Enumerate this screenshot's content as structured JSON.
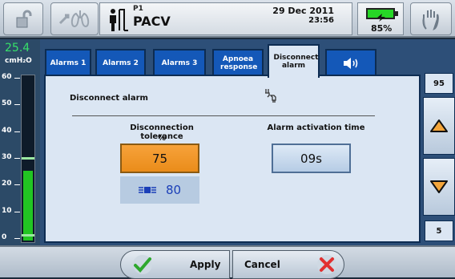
{
  "header": {
    "patient_id": "P1",
    "mode": "PACV",
    "date": "29 Dec 2011",
    "time": "23:56",
    "battery_percent": "85%"
  },
  "gauge": {
    "value": "25.4",
    "unit": "cmH₂O",
    "ticks": [
      "60",
      "50",
      "40",
      "30",
      "20",
      "10",
      "0"
    ],
    "fill_level": 25.4,
    "high_marker": 30,
    "low_marker": 2
  },
  "tabs": [
    {
      "label": "Alarms 1"
    },
    {
      "label": "Alarms 2"
    },
    {
      "label": "Alarms 3"
    },
    {
      "label": "Apnoea response"
    },
    {
      "label": "Disconnect alarm",
      "active": true
    },
    {
      "label": "",
      "icon": "speaker-icon"
    }
  ],
  "content": {
    "section_title": "Disconnect alarm",
    "tolerance_label": "Disconnection tolerance",
    "tolerance_unit": "%",
    "tolerance_value": "75",
    "measured_value": "80",
    "activation_label": "Alarm activation time",
    "activation_value": "09s"
  },
  "stepper": {
    "max": "95",
    "min": "5"
  },
  "footer": {
    "apply_label": "Apply",
    "cancel_label": "Cancel"
  },
  "colors": {
    "accent_orange": "#f7a23a",
    "gauge_green": "#22c522",
    "tab_blue": "#1458b8"
  }
}
